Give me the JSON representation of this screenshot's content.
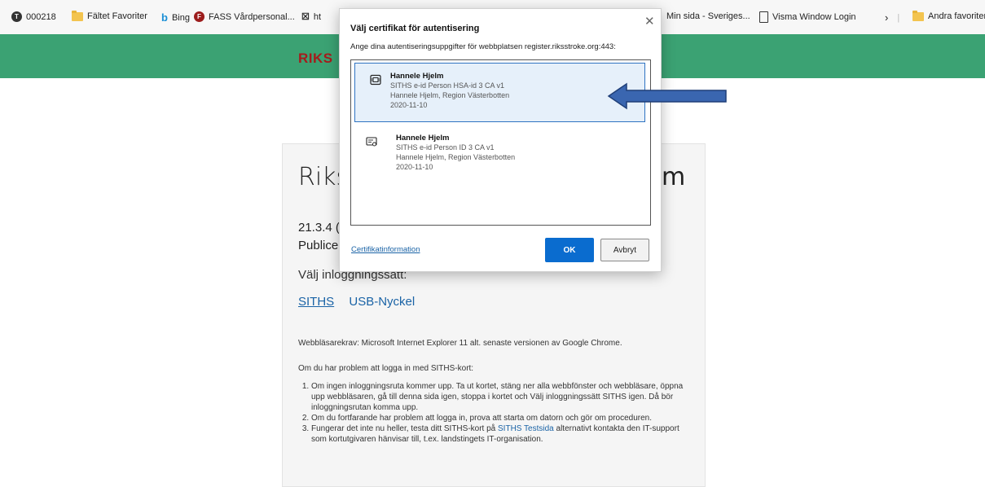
{
  "favorites": [
    {
      "label": "000218",
      "icon": "tumblr-like-icon"
    },
    {
      "label": "Fältet Favoriter",
      "icon": "folder-icon"
    },
    {
      "label": "Bing",
      "icon": "bing-icon"
    },
    {
      "label": "FASS Vårdpersonal...",
      "icon": "fass-icon"
    },
    {
      "label": "ht",
      "icon": "site-icon"
    },
    {
      "label": "Min sida - Sveriges...",
      "icon": ""
    },
    {
      "label": "Visma Window Login",
      "icon": "page-icon"
    },
    {
      "label": "Andra favoriter",
      "icon": "folder-icon"
    }
  ],
  "header": {
    "logo_text": "RIKS",
    "color": "#3ba273"
  },
  "page": {
    "title_start": "Riks",
    "title_end": "m",
    "version": "21.3.4 (",
    "published": "Publice",
    "login_label": "Välj inloggningssätt:",
    "links": [
      "SITHS",
      "USB-Nyckel"
    ],
    "browser_req": "Webbläsarekrav: Microsoft Internet Explorer 11 alt. senaste versionen av Google Chrome.",
    "problem_intro": "Om du har problem att logga in med SITHS-kort:",
    "steps": [
      "Om ingen inloggningsruta kommer upp. Ta ut kortet, stäng ner alla webbfönster och webbläsare, öppna upp webbläsaren, gå till denna sida igen, stoppa i kortet och Välj inloggningssätt SITHS igen. Då bör inloggningsrutan komma upp.",
      "Om du fortfarande har problem att logga in, prova att starta om datorn och gör om proceduren.",
      "Fungerar det inte nu heller, testa ditt SITHS-kort på "
    ],
    "step3_link": "SITHS Testsida",
    "step3_rest": " alternativt kontakta den IT-support som kortutgivaren hänvisar till, t.ex. landstingets IT-organisation."
  },
  "dialog": {
    "title": "Välj certifikat för autentisering",
    "close": "✕",
    "subtitle": "Ange dina autentiseringsuppgifter för webbplatsen register.riksstroke.org:443:",
    "certificates": [
      {
        "name": "Hannele Hjelm",
        "issuer": "SITHS e-id Person HSA-id 3 CA v1",
        "subject": "Hannele Hjelm, Region Västerbotten",
        "date": "2020-11-10",
        "selected": true
      },
      {
        "name": "Hannele Hjelm",
        "issuer": "SITHS e-id Person ID 3 CA v1",
        "subject": "Hannele Hjelm, Region Västerbotten",
        "date": "2020-11-10",
        "selected": false
      }
    ],
    "cert_info_link": "Certifikatinformation",
    "ok_label": "OK",
    "cancel_label": "Avbryt"
  }
}
